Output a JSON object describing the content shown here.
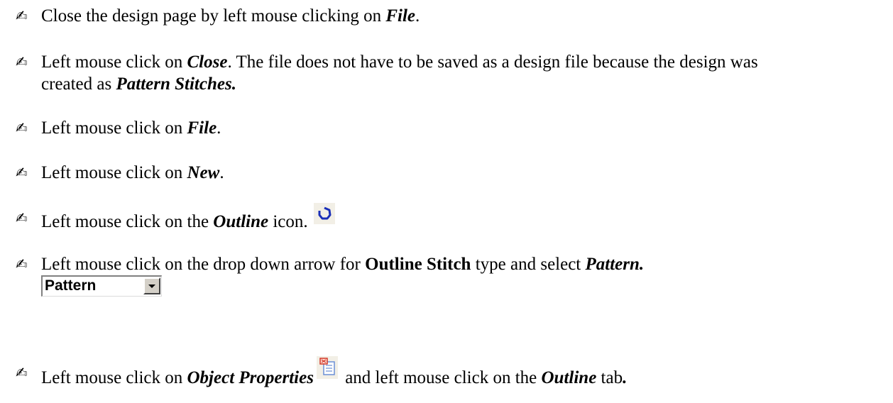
{
  "bullet_glyph": "✍",
  "steps": [
    {
      "prefix": "Close the design page by left mouse clicking on ",
      "emph": "File",
      "suffix": "."
    },
    {
      "prefix": "Left mouse click on ",
      "emph": "Close",
      "suffix": ".  The file does not have to be saved as a design file because the design was",
      "line2_prefix": "created as ",
      "line2_emph": "Pattern Stitches."
    },
    {
      "prefix": "Left mouse click on ",
      "emph": "File",
      "suffix": "."
    },
    {
      "prefix": "Left mouse click on ",
      "emph": "New",
      "suffix": "."
    },
    {
      "prefix": "Left mouse click on the ",
      "emph": "Outline",
      "suffix": "  icon.",
      "icon": "outline-icon"
    },
    {
      "prefix": "Left mouse click on the drop down arrow for ",
      "bold": "Outline Stitch",
      "middle": " type and select ",
      "emph": "Pattern.",
      "dropdown_value": "Pattern"
    },
    {
      "prefix": "Left mouse click on ",
      "emph": "Object Properties",
      "middle": " and left mouse click on the ",
      "emph2": "Outline",
      "suffix": " tab",
      "suffix_emph": ".",
      "icon": "object-properties-icon"
    }
  ],
  "colors": {
    "outline_icon": "#1a2fb8",
    "objprop_red": "#d23a2a",
    "objprop_blue": "#6b8fd6"
  }
}
